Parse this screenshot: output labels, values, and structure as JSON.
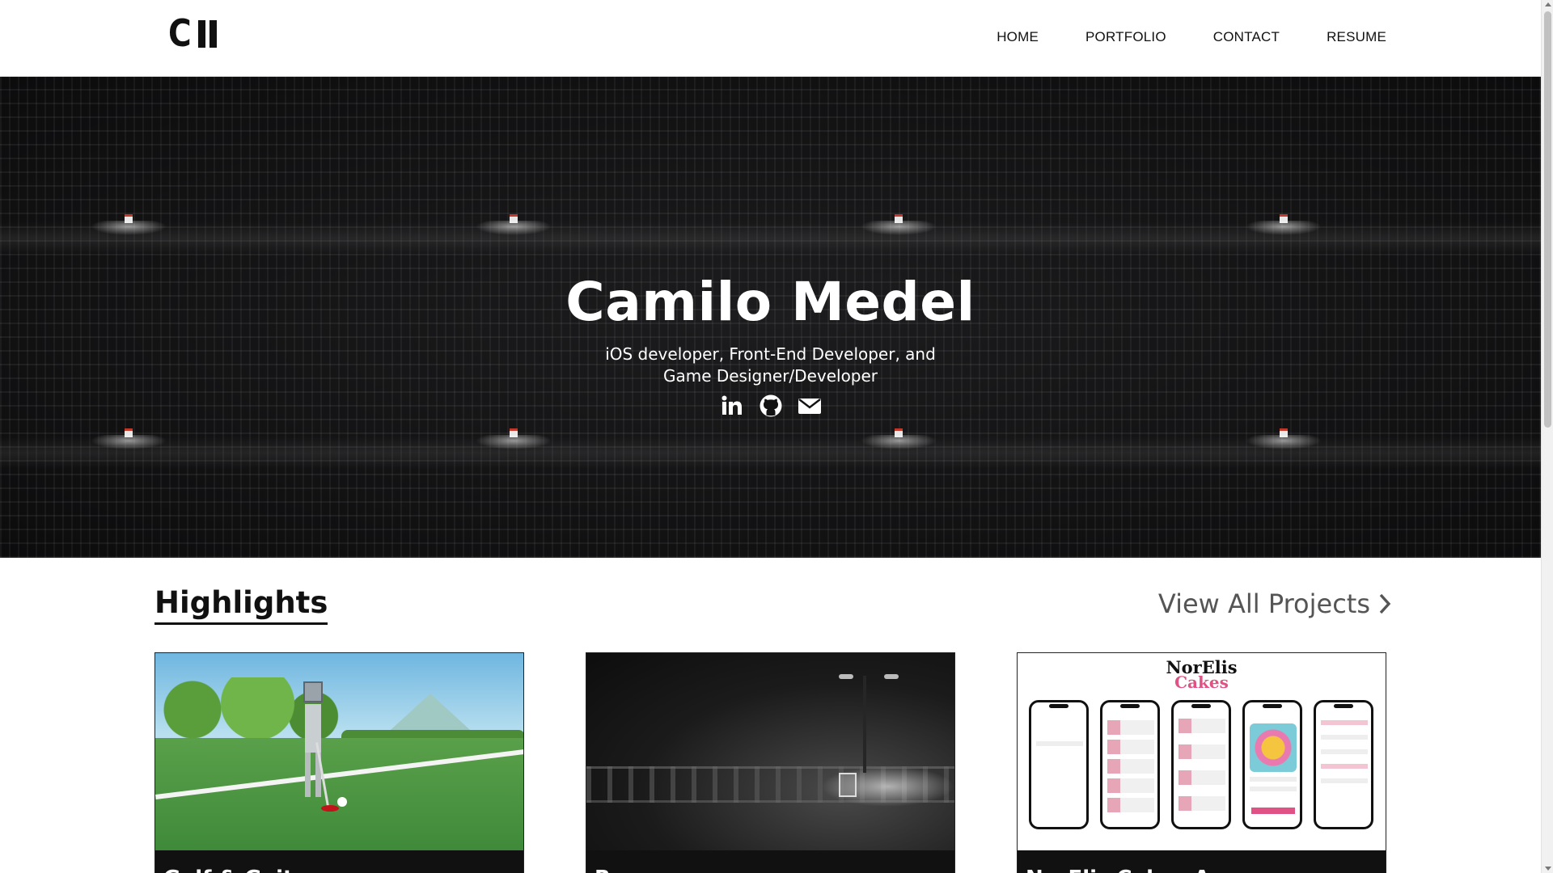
{
  "header": {
    "logo_text": "C",
    "nav": [
      {
        "label": "HOME"
      },
      {
        "label": "PORTFOLIO"
      },
      {
        "label": "CONTACT"
      },
      {
        "label": "RESUME"
      }
    ]
  },
  "hero": {
    "title": "Camilo Medel",
    "subtitle": "iOS developer, Front-End Developer, and Game Designer/Developer",
    "socials": [
      {
        "icon": "linkedin-icon"
      },
      {
        "icon": "github-icon"
      },
      {
        "icon": "envelope-icon"
      }
    ]
  },
  "highlights": {
    "title": "Highlights",
    "view_all": "View All Projects",
    "projects": [
      {
        "title": "Golf & Gait"
      },
      {
        "title": "Run"
      },
      {
        "title": "NorElis Cakes App",
        "logo_line1": "NorElis",
        "logo_line2": "Cakes"
      }
    ]
  },
  "colors": {
    "hero_bg": "#0e0e0f",
    "text_dark": "#111111",
    "link_gray": "#555555",
    "cake_pink": "#e05285"
  }
}
